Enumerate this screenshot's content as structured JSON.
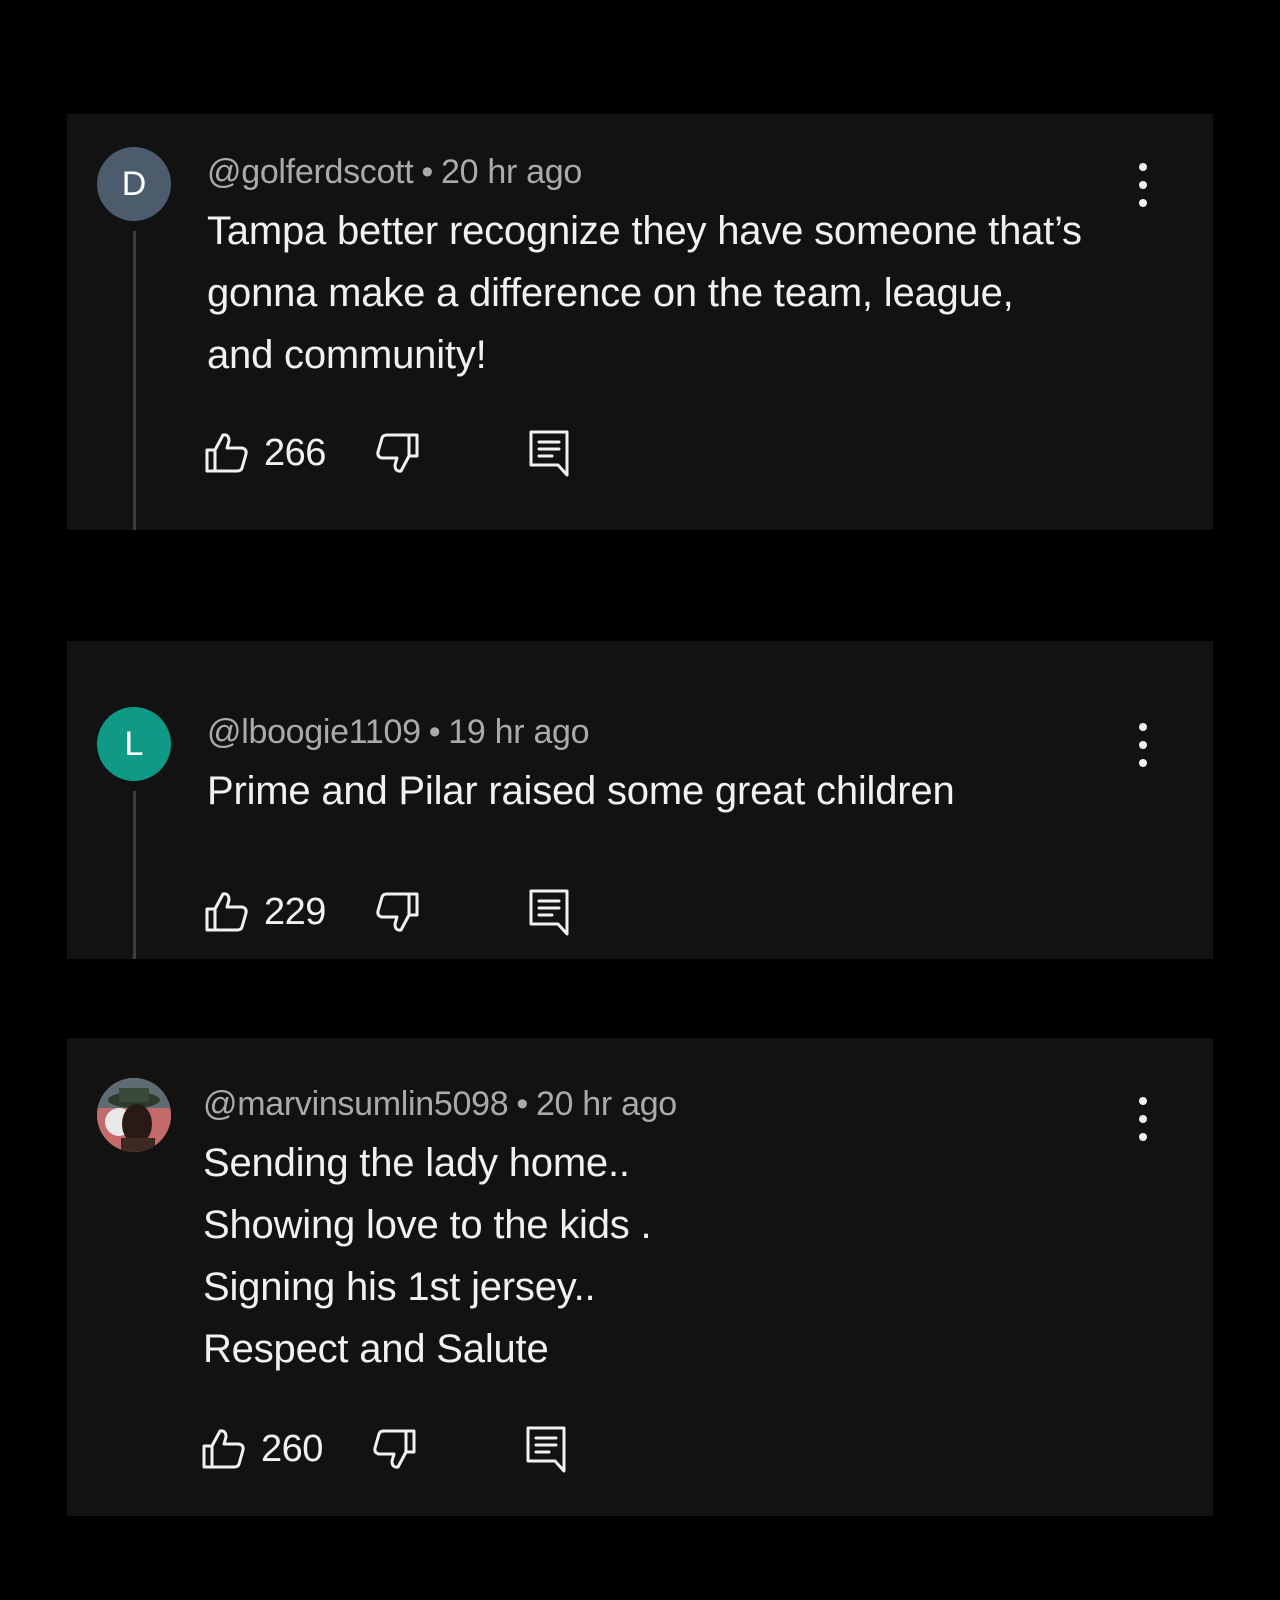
{
  "colors": {
    "page_background": "#000000",
    "card_background": "#121212",
    "text_primary": "#f1f1f1",
    "text_secondary": "#aaaaaa",
    "thread_line": "#3d3d3d"
  },
  "comments": [
    {
      "avatar_letter": "D",
      "avatar_color": "#4c5c6c",
      "handle": "@golferdscott",
      "separator": "•",
      "time": "20 hr ago",
      "lines": [
        "Tampa better recognize they have someone that’s",
        "gonna make a difference on the team, league,",
        "and community!"
      ],
      "likes": "266",
      "icons": [
        "like-icon",
        "dislike-icon",
        "reply-icon",
        "more-vert-icon"
      ]
    },
    {
      "avatar_letter": "L",
      "avatar_color": "#0f9a86",
      "handle": "@lboogie1109",
      "separator": "•",
      "time": "19 hr ago",
      "lines": [
        "Prime and Pilar raised some great children"
      ],
      "likes": "229",
      "icons": [
        "like-icon",
        "dislike-icon",
        "reply-icon",
        "more-vert-icon"
      ]
    },
    {
      "avatar_letter": "",
      "avatar_color": "#c46a6a",
      "handle": "@marvinsumlin5098",
      "separator": "•",
      "time": "20 hr ago",
      "lines": [
        "Sending the lady home..",
        "Showing love to the kids .",
        "Signing his 1st jersey..",
        "Respect and Salute"
      ],
      "likes": "260",
      "icons": [
        "photo-avatar-icon",
        "like-icon",
        "dislike-icon",
        "reply-icon",
        "more-vert-icon"
      ]
    }
  ]
}
